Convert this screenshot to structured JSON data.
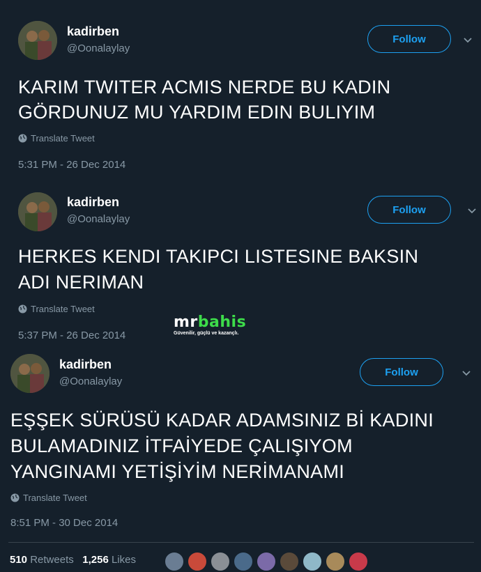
{
  "tweets": [
    {
      "name": "kadirben",
      "handle": "@Oonalaylay",
      "follow_label": "Follow",
      "lines": [
        "KARIM TWITER ACMIS NERDE BU KADIN",
        "GÖRDUNUZ MU YARDIM EDIN BULIYIM"
      ],
      "translate_label": "Translate Tweet",
      "timestamp": "5:31 PM - 26 Dec 2014"
    },
    {
      "name": "kadirben",
      "handle": "@Oonalaylay",
      "follow_label": "Follow",
      "lines": [
        "HERKES KENDI TAKIPCI LISTESINE BAKSIN",
        "ADI NERIMAN"
      ],
      "translate_label": "Translate Tweet",
      "timestamp": "5:37 PM - 26 Dec 2014"
    },
    {
      "name": "kadirben",
      "handle": "@Oonalaylay",
      "follow_label": "Follow",
      "lines": [
        "EŞŞEK SÜRÜSÜ KADAR ADAMSINIZ Bİ KADINI",
        "BULAMADINIZ İTFAİYEDE ÇALIŞIYOM",
        "YANGINAMI YETİŞİYİM NERİMANAMI"
      ],
      "translate_label": "Translate Tweet",
      "timestamp": "8:51 PM - 30 Dec 2014"
    }
  ],
  "watermark": {
    "brand_part1": "mr",
    "brand_part2": "bahis",
    "tagline": "Güvenilir, güçlü ve kazançlı."
  },
  "stats": {
    "retweets_count": "510",
    "retweets_label": "Retweets",
    "likes_count": "1,256",
    "likes_label": "Likes"
  },
  "likers": [
    {
      "icon": "liker-avatar",
      "color": "#6a7d93"
    },
    {
      "icon": "liker-avatar",
      "color": "#c94a3a"
    },
    {
      "icon": "liker-avatar",
      "color": "#8a8f95"
    },
    {
      "icon": "liker-avatar",
      "color": "#4a6a8a"
    },
    {
      "icon": "liker-avatar",
      "color": "#7b6aa8"
    },
    {
      "icon": "liker-avatar",
      "color": "#5a4a3a"
    },
    {
      "icon": "liker-avatar",
      "color": "#8fb8c8"
    },
    {
      "icon": "liker-avatar",
      "color": "#a88a5a"
    },
    {
      "icon": "liker-avatar",
      "color": "#c83a4a"
    }
  ],
  "colors": {
    "background": "#15202b",
    "accent": "#1da1f2",
    "secondary_text": "#8899a6",
    "watermark_green": "#3ddc4a"
  }
}
